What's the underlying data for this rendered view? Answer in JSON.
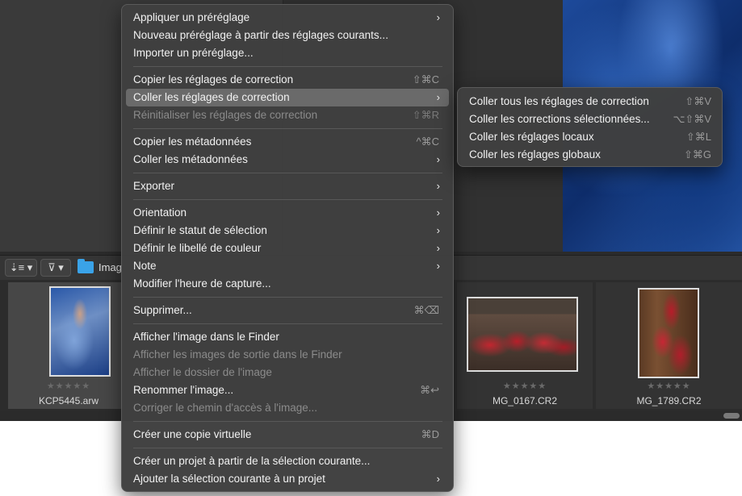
{
  "toolbar": {
    "sort_icon": "⇣≡ ▾",
    "filter_icon": "⊽ ▾",
    "folder_label": "Imag"
  },
  "thumbnails": [
    {
      "name": "KCP5445.arw",
      "stars": "★★★★★"
    },
    {
      "name": "MG_0167.CR2",
      "stars": "★★★★★"
    },
    {
      "name": "MG_1789.CR2",
      "stars": "★★★★★"
    }
  ],
  "menu": {
    "items": [
      {
        "label": "Appliquer un préréglage",
        "shortcut": "",
        "submenu": true
      },
      {
        "label": "Nouveau préréglage à partir des réglages courants...",
        "shortcut": "",
        "submenu": false
      },
      {
        "label": "Importer un préréglage...",
        "shortcut": "",
        "submenu": false
      },
      {
        "label": "Copier les réglages de correction",
        "shortcut": "⇧⌘C",
        "submenu": false
      },
      {
        "label": "Coller les réglages de correction",
        "shortcut": "",
        "submenu": true
      },
      {
        "label": "Réinitialiser les réglages de correction",
        "shortcut": "⇧⌘R",
        "submenu": false
      },
      {
        "label": "Copier les métadonnées",
        "shortcut": "^⌘C",
        "submenu": false
      },
      {
        "label": "Coller les métadonnées",
        "shortcut": "",
        "submenu": true
      },
      {
        "label": "Exporter",
        "shortcut": "",
        "submenu": true
      },
      {
        "label": "Orientation",
        "shortcut": "",
        "submenu": true
      },
      {
        "label": "Définir le statut de sélection",
        "shortcut": "",
        "submenu": true
      },
      {
        "label": "Définir le libellé de couleur",
        "shortcut": "",
        "submenu": true
      },
      {
        "label": "Note",
        "shortcut": "",
        "submenu": true
      },
      {
        "label": "Modifier l'heure de capture...",
        "shortcut": "",
        "submenu": false
      },
      {
        "label": "Supprimer...",
        "shortcut": "⌘⌫",
        "submenu": false
      },
      {
        "label": "Afficher l'image dans le Finder",
        "shortcut": "",
        "submenu": false
      },
      {
        "label": "Afficher les images de sortie dans le Finder",
        "shortcut": "",
        "submenu": false
      },
      {
        "label": "Afficher le dossier de l'image",
        "shortcut": "",
        "submenu": false
      },
      {
        "label": "Renommer l'image...",
        "shortcut": "⌘↩",
        "submenu": false
      },
      {
        "label": "Corriger le chemin d'accès à l'image...",
        "shortcut": "",
        "submenu": false
      },
      {
        "label": "Créer une copie virtuelle",
        "shortcut": "⌘D",
        "submenu": false
      },
      {
        "label": "Créer un projet à partir de la sélection courante...",
        "shortcut": "",
        "submenu": false
      },
      {
        "label": "Ajouter la sélection courante à un projet",
        "shortcut": "",
        "submenu": true
      }
    ],
    "arrow": "›"
  },
  "submenu": {
    "items": [
      {
        "label": "Coller tous les réglages de correction",
        "shortcut": "⇧⌘V"
      },
      {
        "label": "Coller les corrections sélectionnées...",
        "shortcut": "⌥⇧⌘V"
      },
      {
        "label": "Coller les réglages locaux",
        "shortcut": "⇧⌘L"
      },
      {
        "label": "Coller les réglages globaux",
        "shortcut": "⇧⌘G"
      }
    ]
  }
}
